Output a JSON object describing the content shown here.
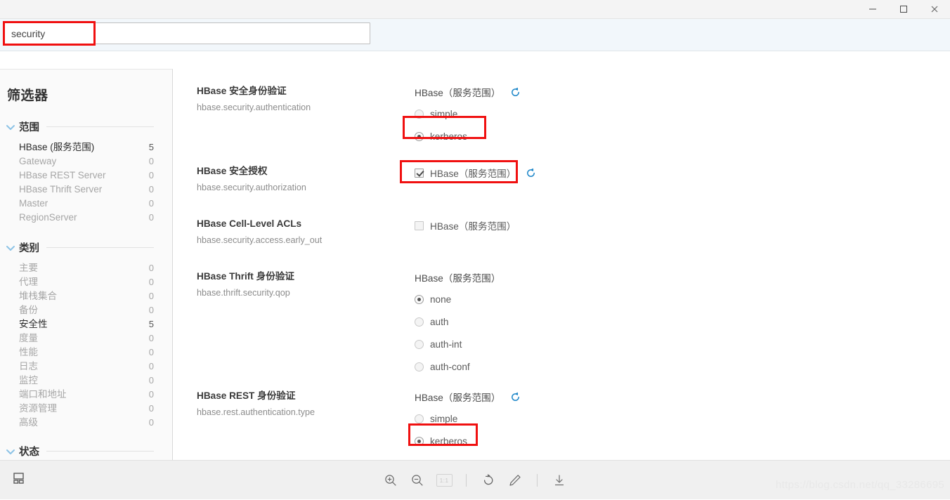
{
  "window": {
    "minimize_label": "−",
    "maximize_label": "□",
    "close_label": "✕"
  },
  "search": {
    "value": "security",
    "placeholder": ""
  },
  "sidebar": {
    "title": "筛选器",
    "groups": [
      {
        "title": "范围",
        "items": [
          {
            "label": "HBase (服务范围)",
            "count": "5",
            "active": true
          },
          {
            "label": "Gateway",
            "count": "0",
            "active": false
          },
          {
            "label": "HBase REST Server",
            "count": "0",
            "active": false
          },
          {
            "label": "HBase Thrift Server",
            "count": "0",
            "active": false
          },
          {
            "label": "Master",
            "count": "0",
            "active": false
          },
          {
            "label": "RegionServer",
            "count": "0",
            "active": false
          }
        ]
      },
      {
        "title": "类别",
        "items": [
          {
            "label": "主要",
            "count": "0",
            "active": false
          },
          {
            "label": "代理",
            "count": "0",
            "active": false
          },
          {
            "label": "堆栈集合",
            "count": "0",
            "active": false
          },
          {
            "label": "备份",
            "count": "0",
            "active": false
          },
          {
            "label": "安全性",
            "count": "5",
            "active": true
          },
          {
            "label": "度量",
            "count": "0",
            "active": false
          },
          {
            "label": "性能",
            "count": "0",
            "active": false
          },
          {
            "label": "日志",
            "count": "0",
            "active": false
          },
          {
            "label": "监控",
            "count": "0",
            "active": false
          },
          {
            "label": "端口和地址",
            "count": "0",
            "active": false
          },
          {
            "label": "资源管理",
            "count": "0",
            "active": false
          },
          {
            "label": "高级",
            "count": "0",
            "active": false
          }
        ]
      },
      {
        "title": "状态",
        "items": []
      }
    ]
  },
  "settings": [
    {
      "name": "HBase 安全身份验证",
      "key": "hbase.security.authentication",
      "scope": "HBase（服务范围）",
      "has_reset": true,
      "options": [
        {
          "label": "simple",
          "selected": false
        },
        {
          "label": "kerberos",
          "selected": true
        }
      ]
    },
    {
      "name": "HBase 安全授权",
      "key": "hbase.security.authorization",
      "scope": "HBase（服务范围）",
      "has_reset": true,
      "checkbox": {
        "label": "HBase（服务范围）",
        "checked": true
      }
    },
    {
      "name": "HBase Cell-Level ACLs",
      "key": "hbase.security.access.early_out",
      "scope": "HBase（服务范围）",
      "has_reset": false,
      "checkbox": {
        "label": "HBase（服务范围）",
        "checked": false
      }
    },
    {
      "name": "HBase Thrift 身份验证",
      "key": "hbase.thrift.security.qop",
      "scope": "HBase（服务范围）",
      "has_reset": false,
      "options": [
        {
          "label": "none",
          "selected": true
        },
        {
          "label": "auth",
          "selected": false
        },
        {
          "label": "auth-int",
          "selected": false
        },
        {
          "label": "auth-conf",
          "selected": false
        }
      ]
    },
    {
      "name": "HBase REST 身份验证",
      "key": "hbase.rest.authentication.type",
      "scope": "HBase（服务范围）",
      "has_reset": true,
      "options": [
        {
          "label": "simple",
          "selected": false
        },
        {
          "label": "kerberos",
          "selected": true
        }
      ]
    }
  ],
  "footer": {
    "ratio_label": "1:1",
    "tools": [
      "zoom-in-icon",
      "zoom-out-icon",
      "actual-size-icon",
      "rotate-icon",
      "edit-icon",
      "download-icon"
    ]
  },
  "watermark": "https://blog.csdn.net/qq_33286695",
  "colors": {
    "accent_blue": "#1e87c9",
    "annotation_red": "#f01010",
    "caret_blue": "#8cc3e6",
    "search_bar_bg": "#f2f7fb"
  }
}
